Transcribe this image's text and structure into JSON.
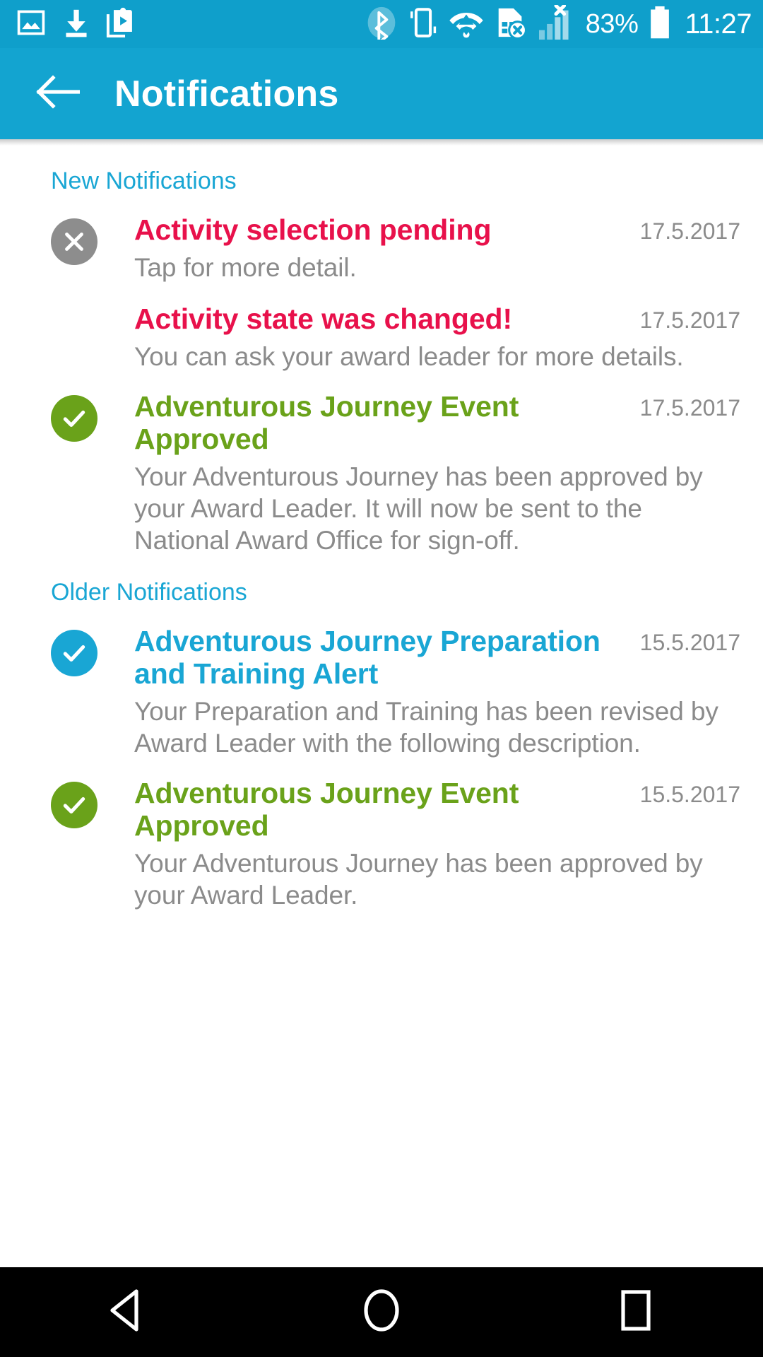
{
  "status_bar": {
    "left_icons": [
      "image-icon",
      "download-icon",
      "media-stack-icon"
    ],
    "right_icons": [
      "bluetooth-icon",
      "vibrate-icon",
      "wifi-icon",
      "sim-error-icon",
      "signal-no-service-icon"
    ],
    "battery_percent": "83%",
    "battery_icon": "battery-full-icon",
    "clock": "11:27"
  },
  "app_bar": {
    "back_icon": "arrow-left-icon",
    "title": "Notifications"
  },
  "sections": [
    {
      "heading": "New Notifications",
      "items": [
        {
          "icon": "close-circle-icon",
          "badge_color": "grey",
          "title": "Activity selection pending",
          "title_color": "red",
          "date": "17.5.2017",
          "text": "Tap for more detail."
        },
        {
          "icon": "none",
          "badge_color": "none",
          "title": "Activity state was changed!",
          "title_color": "red",
          "date": "17.5.2017",
          "text": "You can ask your award leader for more details."
        },
        {
          "icon": "check-circle-icon",
          "badge_color": "green",
          "title": "Adventurous Journey Event Approved",
          "title_color": "green",
          "date": "17.5.2017",
          "text": "Your Adventurous Journey has been approved by your Award Leader. It will now be sent to the National Award Office for sign-off."
        }
      ]
    },
    {
      "heading": "Older Notifications",
      "items": [
        {
          "icon": "check-circle-icon",
          "badge_color": "blue",
          "title": "Adventurous Journey Preparation and Training Alert",
          "title_color": "blue",
          "date": "15.5.2017",
          "text": "Your Preparation and Training has been revised by Award Leader with the following description."
        },
        {
          "icon": "check-circle-icon",
          "badge_color": "green",
          "title": "Adventurous Journey Event Approved",
          "title_color": "green",
          "date": "15.5.2017",
          "text": "Your Adventurous Journey has been approved by your Award Leader."
        }
      ]
    }
  ],
  "nav_bar": {
    "back": "nav-back-triangle-icon",
    "home": "nav-home-circle-icon",
    "recents": "nav-recents-square-icon"
  },
  "colors": {
    "status_bar": "#0f9fcb",
    "app_bar": "#13a4d0",
    "accent_blue": "#19a6d4",
    "accent_red": "#e8114b",
    "accent_green": "#6aa21a",
    "body_grey": "#8b8b8b",
    "badge_grey": "#8d8d8d"
  }
}
